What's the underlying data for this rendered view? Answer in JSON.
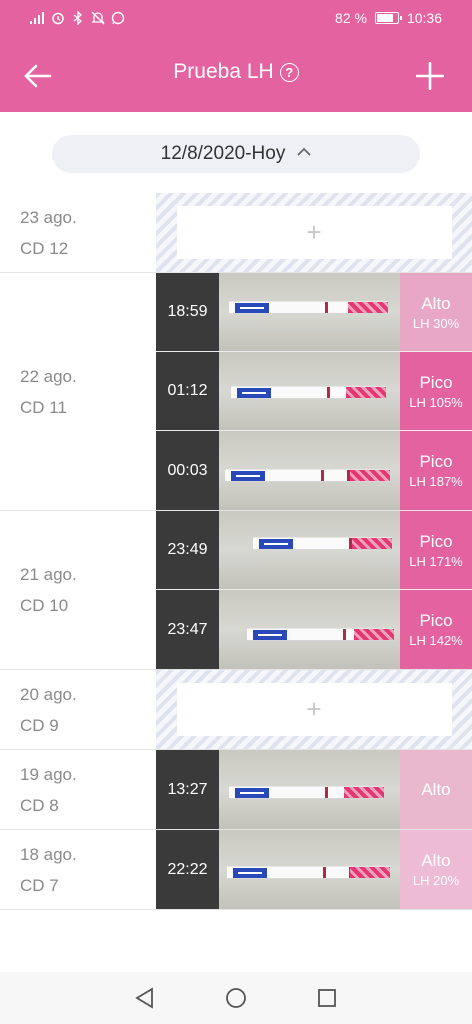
{
  "status": {
    "battery_percent": "82 %",
    "battery_level": 0.82,
    "time": "10:36",
    "icons": [
      "signal-icon",
      "alarm-icon",
      "bluetooth-icon",
      "mute-icon",
      "whatsapp-icon"
    ]
  },
  "header": {
    "title": "Prueba LH",
    "colors": {
      "primary": "#e3629f"
    }
  },
  "date_range": {
    "label": "12/8/2020-Hoy"
  },
  "add_symbol": "+",
  "days": [
    {
      "date": "23 ago.",
      "cd": "CD 12",
      "tests": []
    },
    {
      "date": "22 ago.",
      "cd": "CD 11",
      "tests": [
        {
          "time": "18:59",
          "result": "Alto",
          "lh": "LH 30%"
        },
        {
          "time": "01:12",
          "result": "Pico",
          "lh": "LH 105%"
        },
        {
          "time": "00:03",
          "result": "Pico",
          "lh": "LH 187%"
        }
      ]
    },
    {
      "date": "21 ago.",
      "cd": "CD 10",
      "tests": [
        {
          "time": "23:49",
          "result": "Pico",
          "lh": "LH 171%"
        },
        {
          "time": "23:47",
          "result": "Pico",
          "lh": "LH 142%"
        }
      ]
    },
    {
      "date": "20 ago.",
      "cd": "CD 9",
      "tests": []
    },
    {
      "date": "19 ago.",
      "cd": "CD 8",
      "tests": [
        {
          "time": "13:27",
          "result": "Alto",
          "lh": ""
        }
      ]
    },
    {
      "date": "18 ago.",
      "cd": "CD 7",
      "tests": [
        {
          "time": "22:22",
          "result": "Alto",
          "lh": "LH 20%"
        }
      ]
    }
  ]
}
